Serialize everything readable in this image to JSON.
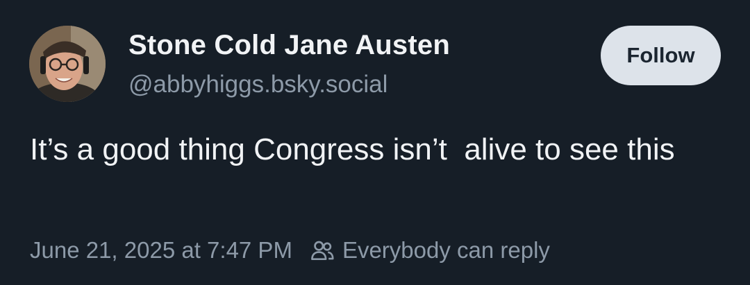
{
  "author": {
    "display_name": "Stone Cold Jane Austen",
    "handle": "@abbyhiggs.bsky.social",
    "avatar_icon": "user-avatar-photo"
  },
  "follow_button": {
    "label": "Follow"
  },
  "post": {
    "text": "It’s a good thing Congress isn’t  alive to see this",
    "timestamp": "June 21, 2025 at 7:47 PM",
    "reply_setting_icon": "people-icon",
    "reply_setting": "Everybody can reply"
  },
  "colors": {
    "background": "#161e27",
    "primary_text": "#f1f3f5",
    "secondary_text": "#8d9aa8",
    "follow_button_bg": "#dde3ea"
  }
}
